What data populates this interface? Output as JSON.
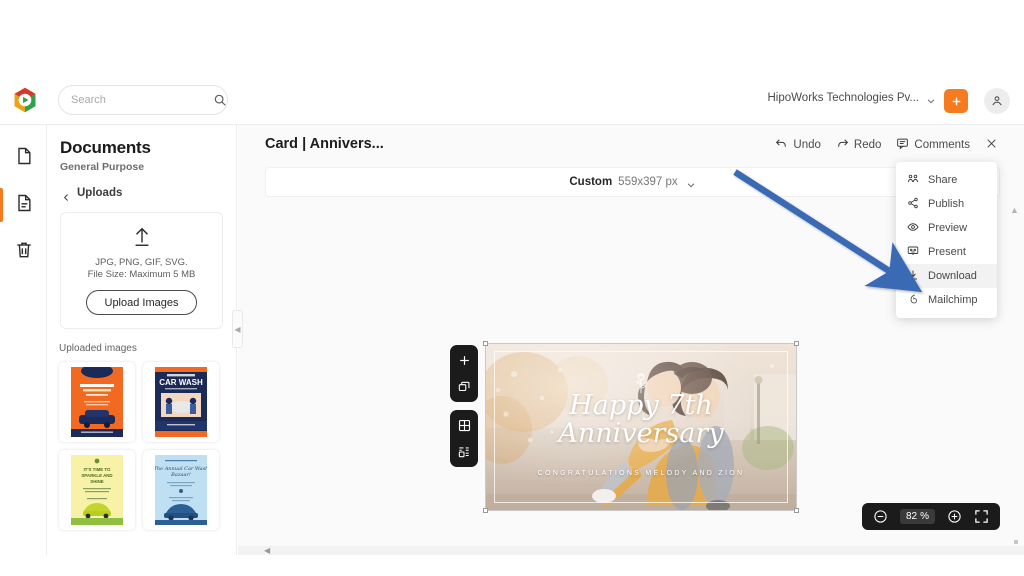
{
  "app": {
    "logo_name": "app-logo",
    "accent_orange": "#f47b20",
    "arrow_color": "#3b6bb5"
  },
  "topbar": {
    "search": {
      "value": "",
      "placeholder": "Search"
    },
    "org_name": "HipoWorks Technologies Pv...",
    "add_label": "+",
    "avatar_label": ""
  },
  "rail": {
    "items": [
      {
        "name": "documents",
        "icon": "page-icon"
      },
      {
        "name": "pages",
        "icon": "page-text-icon",
        "active": true
      },
      {
        "name": "trash",
        "icon": "trash-icon"
      }
    ]
  },
  "sidebar": {
    "title": "Documents",
    "subtitle": "General Purpose",
    "back_label": "Uploads",
    "dropzone": {
      "formats": "JPG, PNG, GIF, SVG.",
      "filesize": "File Size: Maximum 5 MB",
      "button": "Upload Images"
    },
    "uploaded_label": "Uploaded images",
    "thumbs": [
      {
        "name": "thumb-car-service-orange",
        "title": "YOUR DAILY SUMMER PROGRAM"
      },
      {
        "name": "thumb-car-wash-navy",
        "title": "CAR WASH"
      },
      {
        "name": "thumb-sparkle-shine-yellow",
        "title": "IT'S TIME TO SPARKLE AND SHINE"
      },
      {
        "name": "thumb-annual-car-wash-blue",
        "title": "The Annual Car Wash Bazaar"
      }
    ]
  },
  "editor": {
    "doc_title": "Card | Annivers...",
    "actions": [
      {
        "name": "undo",
        "label": "Undo",
        "icon": "undo-icon"
      },
      {
        "name": "redo",
        "label": "Redo",
        "icon": "redo-icon"
      },
      {
        "name": "comments",
        "label": "Comments",
        "icon": "comment-icon"
      },
      {
        "name": "close",
        "label": "",
        "icon": "close-icon"
      }
    ],
    "size_bar": {
      "name": "Custom",
      "dimensions": "559x397 px"
    },
    "zoom": {
      "value": "82",
      "unit": "%"
    },
    "float_tools": [
      {
        "name": "add-page",
        "icon": "plus-icon"
      },
      {
        "name": "duplicate-page",
        "icon": "duplicate-icon"
      },
      {
        "name": "grid-view",
        "icon": "grid-icon"
      },
      {
        "name": "layout-view",
        "icon": "layout-icon"
      }
    ]
  },
  "card": {
    "heading_line1": "Happy 7th",
    "heading_line2": "Anniversary",
    "subtitle": "CONGRATULATIONS MELODY AND ZION",
    "decor_icon": "rose-icon"
  },
  "menu": {
    "items": [
      {
        "label": "Share",
        "icon": "share-users-icon",
        "hover": false
      },
      {
        "label": "Publish",
        "icon": "share-nodes-icon",
        "hover": false
      },
      {
        "label": "Preview",
        "icon": "eye-icon",
        "hover": false
      },
      {
        "label": "Present",
        "icon": "present-icon",
        "hover": false
      },
      {
        "label": "Download",
        "icon": "download-icon",
        "hover": true
      },
      {
        "label": "Mailchimp",
        "icon": "mailchimp-icon",
        "hover": false
      }
    ]
  }
}
